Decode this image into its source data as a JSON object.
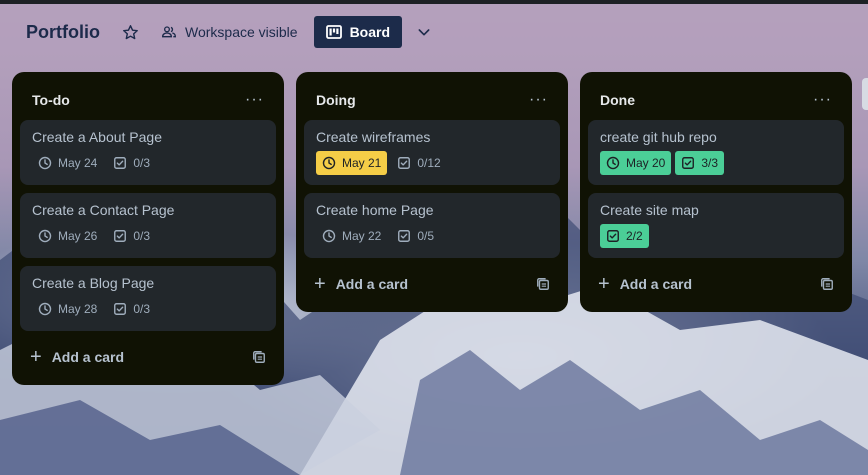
{
  "header": {
    "board_title": "Portfolio",
    "visibility_label": "Workspace visible",
    "view_label": "Board"
  },
  "lists": [
    {
      "title": "To-do",
      "add_label": "Add a card",
      "cards": [
        {
          "title": "Create a About Page",
          "due": "May 24",
          "checklist": "0/3"
        },
        {
          "title": "Create a Contact Page",
          "due": "May 26",
          "checklist": "0/3"
        },
        {
          "title": "Create a Blog Page",
          "due": "May 28",
          "checklist": "0/3"
        }
      ]
    },
    {
      "title": "Doing",
      "add_label": "Add a card",
      "cards": [
        {
          "title": "Create wireframes",
          "due": "May 21",
          "checklist": "0/12",
          "due_status": "due-soon"
        },
        {
          "title": "Create home Page",
          "due": "May 22",
          "checklist": "0/5"
        }
      ]
    },
    {
      "title": "Done",
      "add_label": "Add a card",
      "cards": [
        {
          "title": "create git hub repo",
          "due": "May 20",
          "checklist": "3/3",
          "due_status": "complete"
        },
        {
          "title": "Create site map",
          "checklist": "2/2",
          "checklist_status": "complete"
        }
      ]
    }
  ],
  "colors": {
    "list_bg": "#101204",
    "card_bg": "#22272b",
    "due_soon": "#f5cd47",
    "complete": "#4bce97",
    "header_button": "#1c2b4a"
  },
  "icons": {
    "star": "star-icon",
    "visibility": "people-icon",
    "board": "board-icon",
    "chevron": "chevron-down-icon",
    "list_menu": "ellipsis-icon",
    "due": "clock-icon",
    "checklist": "checkbox-icon",
    "add": "plus-icon",
    "template": "template-icon"
  }
}
